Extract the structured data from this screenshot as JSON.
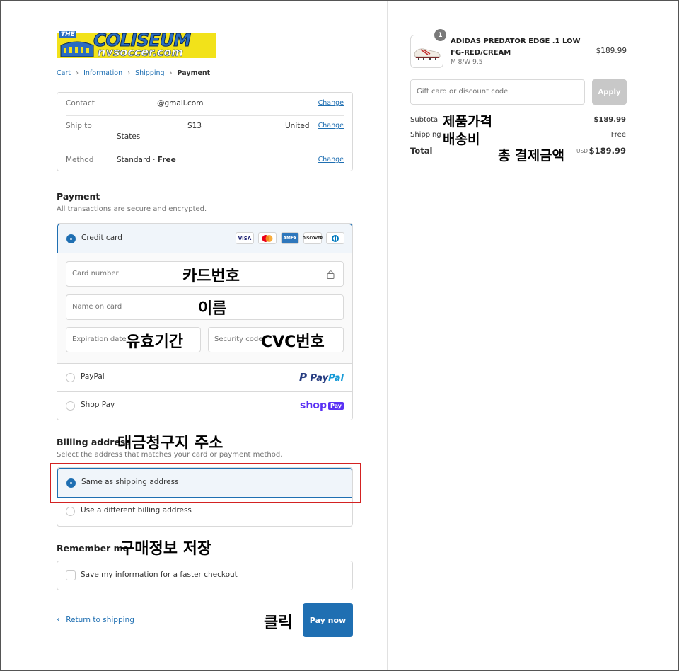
{
  "logo": {
    "the": "THE",
    "top": "COLISEUM",
    "bottom": "nvsoccer.com"
  },
  "breadcrumb": {
    "cart": "Cart",
    "information": "Information",
    "shipping": "Shipping",
    "payment": "Payment"
  },
  "info": {
    "contact_label": "Contact",
    "contact_value": "@gmail.com",
    "ship_label": "Ship to",
    "ship_value_a": "S13",
    "ship_value_b": "United",
    "ship_value_c": "States",
    "method_label": "Method",
    "method_value": "Standard",
    "method_dot": " · ",
    "method_price": "Free",
    "change": "Change"
  },
  "payment": {
    "title": "Payment",
    "subtitle": "All transactions are secure and encrypted.",
    "credit_card": "Credit card",
    "cards": [
      "VISA",
      "",
      "AMEX",
      "DISCOVER",
      ""
    ],
    "card_number_ph": "Card number",
    "name_ph": "Name on card",
    "expiry_ph": "Expiration date",
    "security_ph": "Security code",
    "paypal": "PayPal",
    "paypal_logo_a": "Pay",
    "paypal_logo_b": "Pal",
    "shoppay": "Shop Pay",
    "shoppay_logo_a": "shop",
    "shoppay_logo_b": "Pay"
  },
  "billing": {
    "title": "Billing address",
    "subtitle": "Select the address that matches your card or payment method.",
    "same": "Same as shipping address",
    "different": "Use a different billing address"
  },
  "remember": {
    "title": "Remember me",
    "save": "Save my information for a faster checkout"
  },
  "footer": {
    "return": "Return to shipping",
    "pay_now": "Pay now"
  },
  "annotations": {
    "card_number": "카드번호",
    "name": "이름",
    "expiry": "유효기간",
    "cvc": "CVC번호",
    "billing": "대금청구지 주소",
    "remember": "구매정보 저장",
    "click": "클릭",
    "subtotal": "제품가격",
    "shipping": "배송비",
    "total": "총 결제금액"
  },
  "order": {
    "qty": "1",
    "product_name": "ADIDAS PREDATOR EDGE .1 LOW FG-RED/CREAM",
    "variant": "M 8/W 9.5",
    "price": "$189.99",
    "gift_ph": "Gift card or discount code",
    "apply": "Apply",
    "subtotal_label": "Subtotal",
    "subtotal_value": "$189.99",
    "shipping_label": "Shipping",
    "shipping_value": "Free",
    "total_label": "Total",
    "currency": "USD",
    "total_value": "$189.99"
  },
  "colors": {
    "accent": "#1f6fb2",
    "highlight": "#d32222",
    "shoppay": "#5a31f4"
  }
}
